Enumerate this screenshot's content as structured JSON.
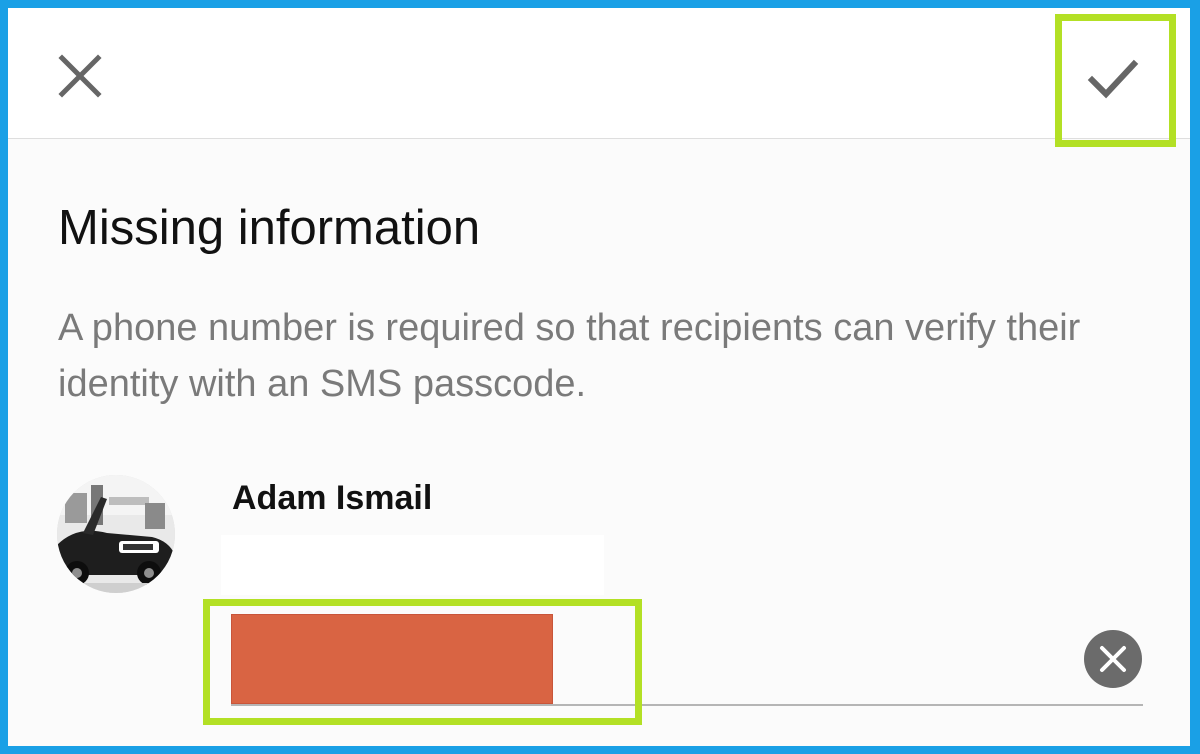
{
  "toolbar": {
    "close_icon": "close-icon",
    "confirm_icon": "checkmark-icon"
  },
  "content": {
    "title": "Missing information",
    "description": "A phone number is required so that recipients can verify their identity with an SMS passcode."
  },
  "recipient": {
    "name": "Adam Ismail",
    "avatar_icon": "avatar-photo",
    "phone_value": "",
    "clear_icon": "clear-circle-icon"
  },
  "colors": {
    "frame_border": "#1aa0e6",
    "highlight": "#b3e025",
    "redacted_field": "#d96443",
    "icon_gray": "#6b6b6b"
  }
}
